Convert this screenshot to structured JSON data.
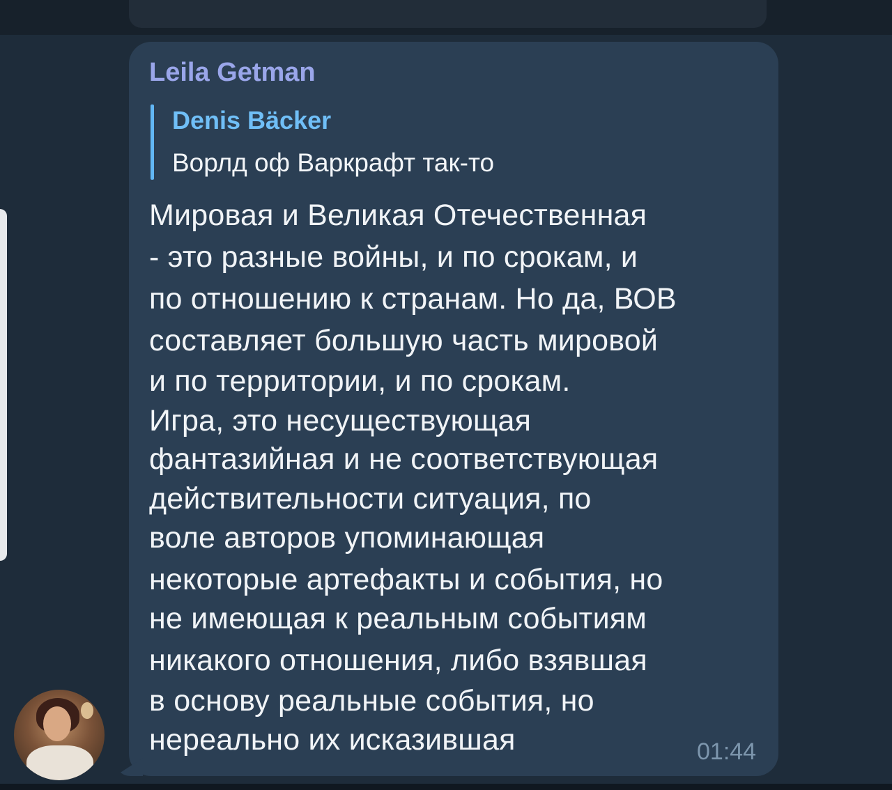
{
  "message": {
    "sender": "Leila Getman",
    "reply": {
      "author": "Denis Bäcker",
      "text": "Ворлд оф Варкрафт так-то"
    },
    "lines": [
      "Мировая и Великая Отечественная",
      "- это разные войны, и по срокам, и",
      "по отношению к странам. Но да, ВОВ",
      "составляет большую часть мировой",
      "и по территории, и по срокам.",
      "Игра, это несуществующая",
      "фантазийная и не соответствующая",
      "действительности ситуация, по",
      "воле авторов упоминающая",
      "некоторые артефакты и события, но",
      "не имеющая к реальным событиям",
      "никакого отношения, либо взявшая",
      "в основу реальные события, но",
      "нереально их исказившая"
    ],
    "time": "01:44"
  },
  "colors": {
    "background": "#1e2c3a",
    "bubble": "#2b3f54",
    "sender_name": "#9aa6ea",
    "reply_author": "#70bff7",
    "reply_bar": "#62b7f5",
    "text": "#f1f4f7",
    "time": "#7d96ad"
  },
  "icons": {
    "avatar": "user-photo-avatar"
  }
}
